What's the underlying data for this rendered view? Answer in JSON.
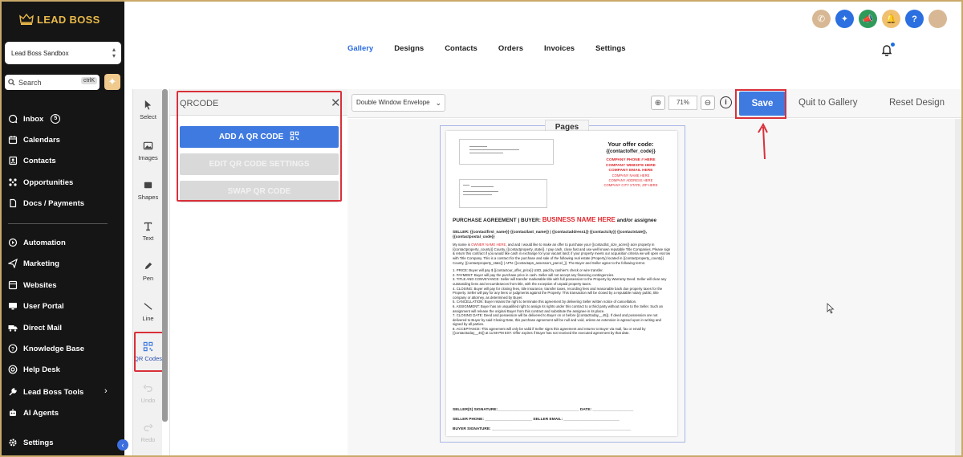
{
  "brand": {
    "name": "LEAD BOSS",
    "gold": "#e8b84a"
  },
  "account": {
    "name": "Lead Boss Sandbox"
  },
  "search": {
    "placeholder": "Search",
    "shortcut": "ctrlK"
  },
  "sidebar": {
    "inbox_badge": "5",
    "items": [
      {
        "label": "Inbox",
        "icon": "chat-bubble-icon"
      },
      {
        "label": "Calendars",
        "icon": "calendar-icon"
      },
      {
        "label": "Contacts",
        "icon": "contacts-icon"
      },
      {
        "label": "Opportunities",
        "icon": "opportunities-icon"
      },
      {
        "label": "Docs / Payments",
        "icon": "docs-icon"
      },
      {
        "label": "Automation",
        "icon": "automation-icon"
      },
      {
        "label": "Marketing",
        "icon": "send-icon"
      },
      {
        "label": "Websites",
        "icon": "websites-icon"
      },
      {
        "label": "User Portal",
        "icon": "monitor-icon"
      },
      {
        "label": "Direct Mail",
        "icon": "truck-icon"
      },
      {
        "label": "Knowledge Base",
        "icon": "help-circle-icon"
      },
      {
        "label": "Help Desk",
        "icon": "lifebuoy-icon"
      },
      {
        "label": "Lead Boss Tools",
        "icon": "wrench-icon"
      },
      {
        "label": "AI Agents",
        "icon": "robot-icon"
      }
    ],
    "settings_label": "Settings"
  },
  "tabs": [
    "Gallery",
    "Designs",
    "Contacts",
    "Orders",
    "Invoices",
    "Settings"
  ],
  "active_tab": "Gallery",
  "tools": [
    {
      "label": "Select",
      "icon": "pointer-icon"
    },
    {
      "label": "Images",
      "icon": "image-icon"
    },
    {
      "label": "Shapes",
      "icon": "shapes-icon"
    },
    {
      "label": "Text",
      "icon": "text-icon"
    },
    {
      "label": "Pen",
      "icon": "pen-icon"
    },
    {
      "label": "Line",
      "icon": "line-icon"
    },
    {
      "label": "QR Codes",
      "icon": "qr-code-icon"
    },
    {
      "label": "Undo",
      "icon": "undo-icon"
    },
    {
      "label": "Redo",
      "icon": "redo-icon"
    }
  ],
  "qr_panel": {
    "title": "QRCODE",
    "add_label": "ADD A QR CODE",
    "edit_label": "EDIT QR CODE SETTINGS",
    "swap_label": "SWAP QR CODE"
  },
  "toolbar": {
    "envelope": "Double Window Envelope",
    "zoom": "71%",
    "save": "Save",
    "quit": "Quit to Gallery",
    "reset": "Reset Design"
  },
  "canvas": {
    "pages_label": "Pages"
  },
  "document": {
    "offer_title": "Your offer code:",
    "offer_code": "{{contactoffer_code}}",
    "offer_red": [
      "COMPANY PHONE # HERE",
      "COMPANY WEBSITE HERE",
      "COMPANY EMAIL HERE"
    ],
    "offer_red_small": [
      "COMPANY NAME HERE",
      "COMPANY ADDRESS HERE",
      "COMPANY CITY STATE, ZIP HERE"
    ],
    "pa_prefix": "PURCHASE AGREEMENT | BUYER: ",
    "pa_business": "BUSINESS NAME HERE",
    "pa_suffix": " and/or assignee",
    "seller_line": "SELLER:  {{contactfirst_name}} {{contactlast_name}} | {{contactaddress1}} {{contactcity}} {{contactstate}}, {{contactpostal_code}}",
    "intro_a": "My name is ",
    "intro_owner": "OWNER NAME HERE",
    "intro_b": ", and and I would like to make an offer to purchase your {{contactlot_size_acres}} acre property in {{contactproperty_county}} County, {{contactproperty_state}}. I pay cash, close fast and use well known reputable Title Companies. Please sign & return this contract if you would like cash in exchange for your vacant land; if your property meets our acquisition criteria we will open escrow with Title Company. This is a contract for the purchase and sale of the following real estate (Property) located in {{contactproperty_county}} County, {{contactproperty_state}} | APN: {{contactapn_assessors_parcel_}}. The Buyer and Seller agree to the following terms:",
    "terms": [
      "1. PRICE: Buyer will pay $ {{contactour_offer_price}} USD, paid by cashier's check or wire transfer.",
      "2. PAYMENT: Buyer will pay the purchase price in cash. Seller will not accept any financing contingencies.",
      "3. TITLE AND CONVEYANCE: Seller will transfer marketable title with full possession to the Property by Warranty Deed. Seller will clear any outstanding liens and encumbrances from title, with the exception of unpaid property taxes.",
      "4. CLOSING: Buyer will pay for closing fees, title insurance, transfer taxes, recording fees and reasonable back due property taxes for the Property. Seller will pay for any liens or judgments against the Property. This transaction will be closed by a reputable notary public, title company or attorney, as determined by Buyer.",
      "5. CANCELLATION: Buyer retains the right to terminate this agreement by delivering Seller written notice of cancellation.",
      "6. ASSIGNMENT: Buyer has an unqualified right to assign its rights under this contract to a third party without notice to the Seller. Such an assignment will release the original Buyer from this contract and substitute the assignee in its place.",
      "7. CLOSING DATE: Deed and possession will be delivered to Buyer on or before {{contacttoday__45}}. If deed and possession are not delivered to Buyer by said Closing Date, this purchase agreement will be null and void, unless an extension is agreed upon in writing and signed by all parties.",
      "8. ACCEPTANCE: This agreement will only be valid if Seller signs this agreement and returns to Buyer via mail, fax or email by {{contacttoday__45}} at 11:59 PM EST. Offer expires if Buyer has not received the executed agreement by that date."
    ],
    "sig_seller": "SELLER(S) SIGNATURE:______________________________________ DATE: ___________________",
    "sig_phone": "SELLER PHONE: ______________________ SELLER EMAIL: __________________________",
    "sig_buyer": "BUYER SIGNATURE: _________________________________________________________________"
  },
  "colors": {
    "accent": "#3f7ae0",
    "highlight": "#d9303a",
    "sidebar_bg": "#151515"
  }
}
